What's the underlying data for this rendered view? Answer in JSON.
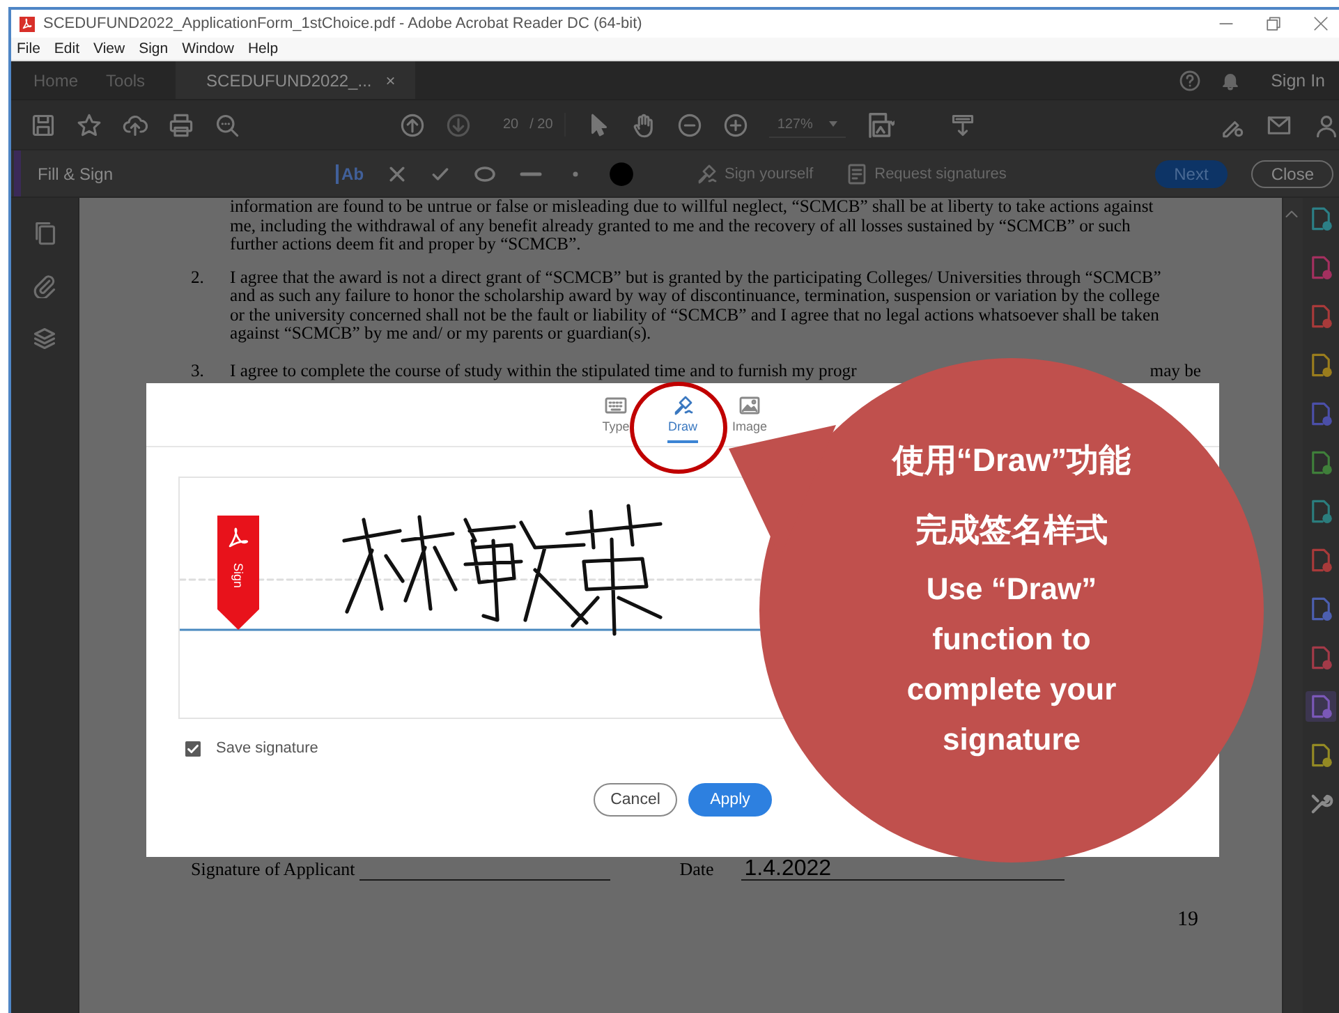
{
  "window": {
    "title": "SCEDUFUND2022_ApplicationForm_1stChoice.pdf - Adobe Acrobat Reader DC (64-bit)"
  },
  "menu": [
    "File",
    "Edit",
    "View",
    "Sign",
    "Window",
    "Help"
  ],
  "tabs": [
    {
      "label": "Home",
      "selected": false
    },
    {
      "label": "Tools",
      "selected": false
    },
    {
      "label": "SCEDUFUND2022_...",
      "selected": true,
      "close_glyph": "×"
    }
  ],
  "header_right": {
    "sign_in": "Sign In"
  },
  "toolbar": {
    "page": "20",
    "page_total": "/ 20",
    "zoom": "127%"
  },
  "fill_sign": {
    "title": "Fill & Sign",
    "text_tool": "Ab",
    "sign_yourself": "Sign yourself",
    "request_signatures": "Request signatures",
    "next": "Next",
    "close": "Close"
  },
  "document": {
    "paragraphs": [
      {
        "lines": [
          "information are found to be untrue or false or misleading due to willful neglect, “SCMCB” shall be at liberty to take actions against",
          "me, including the withdrawal of any benefit already granted to me and the recovery of all losses sustained by “SCMCB” or such",
          "further actions deem fit and proper by “SCMCB”."
        ]
      },
      {
        "number": "2.",
        "lines": [
          "I agree that the award is not a direct grant of “SCMCB” but is granted by the participating Colleges/ Universities through “SCMCB”",
          "and as such any failure to honor the scholarship award by way of discontinuance, termination, suspension or variation by the college",
          "or the university concerned shall not be the fault or liability of “SCMCB” and I agree that no legal actions whatsoever shall be taken",
          "against “SCMCB” by me and/ or my parents or guardian(s)."
        ]
      },
      {
        "number": "3.",
        "lines": [
          "I agree to complete the course of study within the stipulated time and to furnish my progr"
        ],
        "line_end": "may be"
      }
    ],
    "signature_label": "Signature of Applicant",
    "date_label": "Date",
    "date_value": "1.4.2022",
    "page_number": "19"
  },
  "dialog": {
    "tabs": [
      {
        "label": "Type",
        "selected": false
      },
      {
        "label": "Draw",
        "selected": true
      },
      {
        "label": "Image",
        "selected": false
      }
    ],
    "sign_flag": "Sign",
    "save_signature": {
      "label": "Save signature",
      "checked": true
    },
    "buttons": [
      {
        "label": "Cancel",
        "kind": "secondary"
      },
      {
        "label": "Apply",
        "kind": "primary"
      }
    ]
  },
  "callout": {
    "lines": [
      {
        "text": "使用“Draw”功能",
        "kind": "zh"
      },
      {
        "text": "完成签名样式",
        "kind": "zh"
      },
      {
        "text": "Use “Draw”",
        "kind": "en"
      },
      {
        "text": "function to",
        "kind": "en"
      },
      {
        "text": "complete your",
        "kind": "en"
      },
      {
        "text": "signature",
        "kind": "en"
      }
    ]
  },
  "right_tools": [
    {
      "kind": "tool",
      "color": "#2c7f86",
      "selected": false
    },
    {
      "kind": "tool",
      "color": "#a3305f",
      "selected": false
    },
    {
      "kind": "tool",
      "color": "#a83a3a",
      "selected": false
    },
    {
      "kind": "tool",
      "color": "#9a7d1d",
      "selected": false
    },
    {
      "kind": "tool",
      "color": "#4b4fa8",
      "selected": false
    },
    {
      "kind": "tool",
      "color": "#3f7f3a",
      "selected": false
    },
    {
      "kind": "tool",
      "color": "#2b7d7d",
      "selected": false
    },
    {
      "kind": "tool",
      "color": "#a83a3a",
      "selected": false
    },
    {
      "kind": "tool",
      "color": "#4c5fb0",
      "selected": false
    },
    {
      "kind": "tool",
      "color": "#a33a48",
      "selected": false
    },
    {
      "kind": "tool",
      "color": "#7b58b8",
      "selected": true
    },
    {
      "kind": "tool",
      "color": "#948a24",
      "selected": false
    },
    {
      "kind": "wrench",
      "color": "#8a8a8a",
      "selected": false
    }
  ]
}
